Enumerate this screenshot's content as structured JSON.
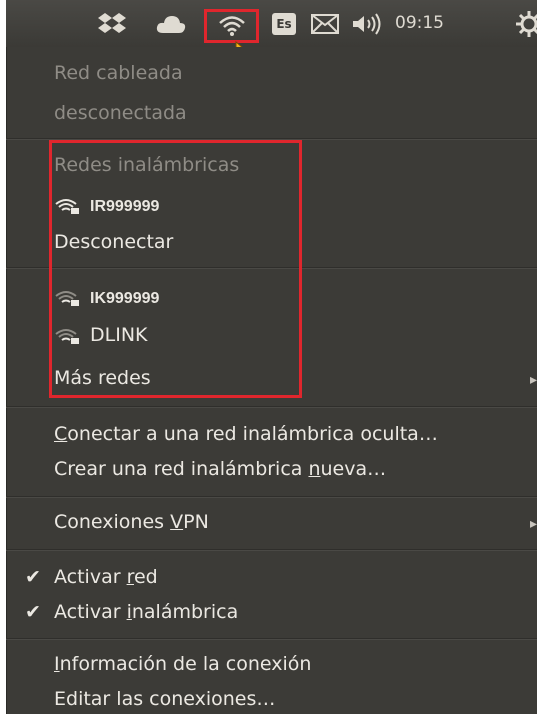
{
  "panel": {
    "keyboard_layout": "Es",
    "time": "09:15",
    "icons": [
      "dropbox-icon",
      "cloud-icon",
      "wifi-icon",
      "mail-icon",
      "volume-icon",
      "power-gear-icon"
    ]
  },
  "menu": {
    "wired_header": "Red cableada",
    "wired_status": "desconectada",
    "wireless_header": "Redes inalámbricas",
    "connected_network": "IR999999",
    "disconnect": "Desconectar",
    "networks": [
      "IK999999",
      "DLINK"
    ],
    "more_networks": "Más redes",
    "hidden_prefix": "C",
    "hidden_suffix": "onectar a una red inalámbrica oculta…",
    "create_prefix": "Crear una red inalámbrica ",
    "create_mn": "n",
    "create_suffix": "ueva…",
    "vpn_prefix": "Conexiones ",
    "vpn_mn": "V",
    "vpn_suffix": "PN",
    "enable_net_prefix": "Activar ",
    "enable_net_mn": "r",
    "enable_net_suffix": "ed",
    "enable_wifi_prefix": "Activar ",
    "enable_wifi_mn": "i",
    "enable_wifi_suffix": "nalámbrica",
    "check_mark": "✔",
    "info_mn": "I",
    "info_suffix": "nformación de la conexión",
    "edit": "Editar las conexiones…",
    "submenu_arrow": "▸"
  },
  "colors": {
    "highlight": "#e0262d",
    "menu_bg": "#3c3b37",
    "panel_bg": "#3c3b37"
  }
}
